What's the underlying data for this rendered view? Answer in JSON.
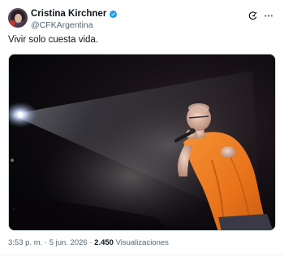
{
  "post": {
    "author": {
      "display_name": "Cristina Kirchner",
      "handle": "@CFKArgentina",
      "verified": true
    },
    "text": "Vivir solo cuesta vida.",
    "meta": {
      "time": "3:53 p. m.",
      "separator": "·",
      "date": "5 jun. 2026",
      "views_count": "2.450",
      "views_label": "Visualizaciones"
    },
    "icons": {
      "verified": "verified-badge-icon",
      "grok": "grok-icon",
      "more": "more-options-icon"
    },
    "colors": {
      "verified_blue": "#1d9bf0",
      "secondary_text": "#536471",
      "primary_text": "#0f1419",
      "shirt_orange": "#f07c1e"
    }
  }
}
